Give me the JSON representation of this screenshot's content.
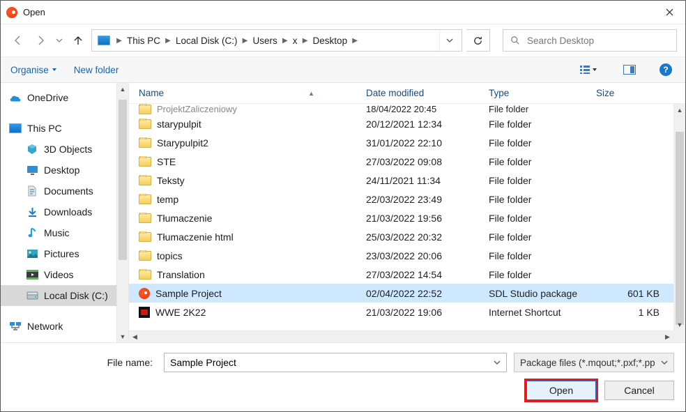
{
  "window": {
    "title": "Open"
  },
  "breadcrumbs": [
    "This PC",
    "Local Disk (C:)",
    "Users",
    "x",
    "Desktop"
  ],
  "search": {
    "placeholder": "Search Desktop"
  },
  "toolbar": {
    "organise": "Organise",
    "new_folder": "New folder"
  },
  "nav": {
    "onedrive": "OneDrive",
    "thispc": "This PC",
    "items": [
      "3D Objects",
      "Desktop",
      "Documents",
      "Downloads",
      "Music",
      "Pictures",
      "Videos",
      "Local Disk (C:)"
    ],
    "network": "Network"
  },
  "columns": {
    "name": "Name",
    "date": "Date modified",
    "type": "Type",
    "size": "Size"
  },
  "rows": [
    {
      "name": "ProjektZaliczeniowy",
      "date": "18/04/2022 20:45",
      "type": "File folder",
      "size": "",
      "icon": "folder",
      "cut": true
    },
    {
      "name": "starypulpit",
      "date": "20/12/2021 12:34",
      "type": "File folder",
      "size": "",
      "icon": "folder"
    },
    {
      "name": "Starypulpit2",
      "date": "31/01/2022 22:10",
      "type": "File folder",
      "size": "",
      "icon": "folder"
    },
    {
      "name": "STE",
      "date": "27/03/2022 09:08",
      "type": "File folder",
      "size": "",
      "icon": "folder"
    },
    {
      "name": "Teksty",
      "date": "24/11/2021 11:34",
      "type": "File folder",
      "size": "",
      "icon": "folder"
    },
    {
      "name": "temp",
      "date": "22/03/2022 23:49",
      "type": "File folder",
      "size": "",
      "icon": "folder"
    },
    {
      "name": "Tłumaczenie",
      "date": "21/03/2022 19:56",
      "type": "File folder",
      "size": "",
      "icon": "folder"
    },
    {
      "name": "Tłumaczenie html",
      "date": "25/03/2022 20:32",
      "type": "File folder",
      "size": "",
      "icon": "folder"
    },
    {
      "name": "topics",
      "date": "23/03/2022 20:06",
      "type": "File folder",
      "size": "",
      "icon": "folder"
    },
    {
      "name": "Translation",
      "date": "27/03/2022 14:54",
      "type": "File folder",
      "size": "",
      "icon": "folder"
    },
    {
      "name": "Sample Project",
      "date": "02/04/2022 22:52",
      "type": "SDL Studio package",
      "size": "601 KB",
      "icon": "pkg",
      "selected": true
    },
    {
      "name": "WWE 2K22",
      "date": "21/03/2022 19:06",
      "type": "Internet Shortcut",
      "size": "1 KB",
      "icon": "wwe"
    }
  ],
  "footer": {
    "label": "File name:",
    "value": "Sample Project",
    "filter": "Package files (*.mqout;*.pxf;*.pp",
    "open": "Open",
    "cancel": "Cancel"
  }
}
